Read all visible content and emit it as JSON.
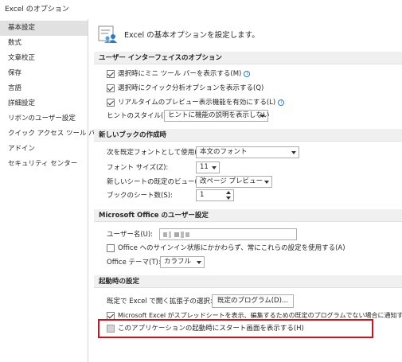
{
  "window": {
    "title": "Excel のオプション"
  },
  "sidebar": {
    "items": [
      {
        "label": "基本設定"
      },
      {
        "label": "数式"
      },
      {
        "label": "文章校正"
      },
      {
        "label": "保存"
      },
      {
        "label": "言語"
      },
      {
        "label": "詳細設定"
      },
      {
        "label": "リボンのユーザー設定"
      },
      {
        "label": "クイック アクセス ツール バー"
      },
      {
        "label": "アドイン"
      },
      {
        "label": "セキュリティ センター"
      }
    ]
  },
  "main": {
    "header": "Excel の基本オプションを設定します。",
    "ui_section": {
      "title": "ユーザー インターフェイスのオプション",
      "opt1": "選択時にミニ ツール バーを表示する(M)",
      "opt2": "選択時にクイック分析オプションを表示する(Q)",
      "opt3": "リアルタイムのプレビュー表示機能を有効にする(L)",
      "tooltip_label": "ヒントのスタイル(R):",
      "tooltip_value": "ヒントに機能の説明を表示しない"
    },
    "workbook_section": {
      "title": "新しいブックの作成時",
      "font_label": "次を既定フォントとして使用(N):",
      "font_value": "本文のフォント",
      "size_label": "フォント サイズ(Z):",
      "size_value": "11",
      "view_label": "新しいシートの既定のビュー(V):",
      "view_value": "改ページ プレビュー",
      "sheets_label": "ブックのシート数(S):",
      "sheets_value": "1"
    },
    "office_section": {
      "title": "Microsoft Office のユーザー設定",
      "user_label": "ユーザー名(U):",
      "always_use": "Office へのサインイン状態にかかわらず、常にこれらの設定を使用する(A)",
      "theme_label": "Office テーマ(T):",
      "theme_value": "カラフル"
    },
    "startup_section": {
      "title": "起動時の設定",
      "ext_label": "既定で Excel で開く拡張子の選択:",
      "default_programs_button": "既定のプログラム(D)...",
      "notify": "Microsoft Excel がスプレッドシートを表示、編集するための既定のプログラムでない場合に通知する(T)",
      "start_screen": "このアプリケーションの起動時にスタート画面を表示する(H)"
    }
  },
  "colors": {
    "highlight": "#d0121b",
    "active_sidebar": "#e1e1e1",
    "section_bg": "#f0f0f0"
  }
}
